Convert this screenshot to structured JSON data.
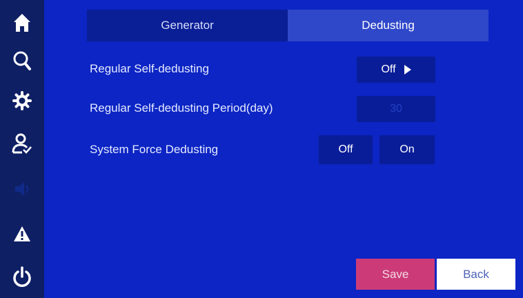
{
  "sidebar": {
    "items": [
      {
        "icon": "home-icon"
      },
      {
        "icon": "search-icon"
      },
      {
        "icon": "gear-icon"
      },
      {
        "icon": "user-check-icon"
      },
      {
        "icon": "speaker-icon"
      },
      {
        "icon": "warning-icon"
      },
      {
        "icon": "power-icon"
      }
    ]
  },
  "tabs": [
    {
      "label": "Generator",
      "active": false
    },
    {
      "label": "Dedusting",
      "active": true
    }
  ],
  "settings": {
    "regular_self_dedusting": {
      "label": "Regular Self-dedusting",
      "value": "Off"
    },
    "period": {
      "label": "Regular Self-dedusting Period(day)",
      "value": "30"
    },
    "force_dedusting": {
      "label": "System Force Dedusting",
      "off_label": "Off",
      "on_label": "On"
    }
  },
  "actions": {
    "save_label": "Save",
    "back_label": "Back"
  },
  "colors": {
    "background": "#0c25c4",
    "sidebar": "#0e1f64",
    "save": "#cc3b78",
    "back": "#ffffff"
  }
}
